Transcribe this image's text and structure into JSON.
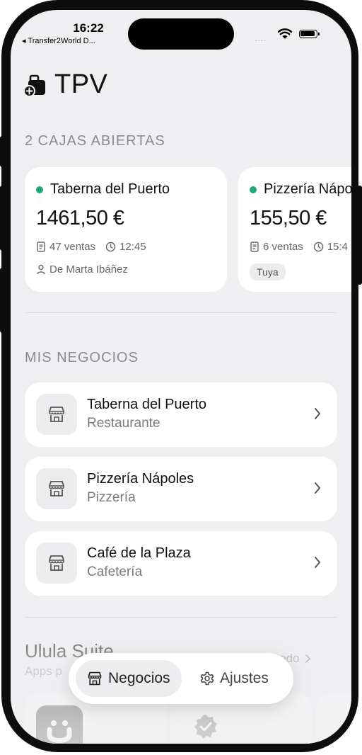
{
  "status_bar": {
    "time": "16:22",
    "back_app": "◂ Transfer2World D...",
    "signal_dots": "····"
  },
  "header": {
    "title": "TPV"
  },
  "open_registers": {
    "label": "2 CAJAS ABIERTAS",
    "cards": [
      {
        "business": "Taberna del Puerto",
        "amount": "1461,50 €",
        "sales": "47 ventas",
        "time": "12:45",
        "owner": "De Marta Ibáñez"
      },
      {
        "business": "Pizzería Nápoles",
        "amount": "155,50 €",
        "sales": "6 ventas",
        "time": "15:4",
        "badge": "Tuya"
      }
    ]
  },
  "my_businesses": {
    "label": "MIS NEGOCIOS",
    "items": [
      {
        "name": "Taberna del Puerto",
        "type": "Restaurante"
      },
      {
        "name": "Pizzería Nápoles",
        "type": "Pizzería"
      },
      {
        "name": "Café de la Plaza",
        "type": "Cafetería"
      }
    ]
  },
  "suite": {
    "title": "Ulula Suite",
    "subtitle": "Apps p",
    "see_all": "r todo"
  },
  "tabbar": {
    "tabs": [
      {
        "label": "Negocios",
        "active": true
      },
      {
        "label": "Ajustes",
        "active": false
      }
    ]
  },
  "colors": {
    "accent_green": "#1daa79",
    "background": "#efeff1",
    "card": "#ffffff"
  }
}
